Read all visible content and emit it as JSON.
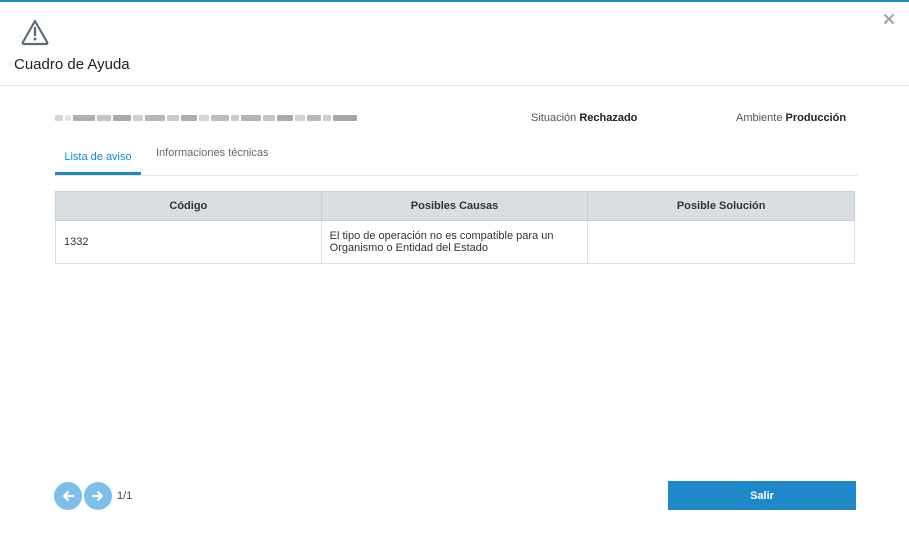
{
  "modal": {
    "title": "Cuadro de Ayuda",
    "warning_icon": "warning-triangle-icon",
    "close_icon": "close-icon"
  },
  "info": {
    "situacion_label": "Situación",
    "situacion_value": "Rechazado",
    "ambiente_label": "Ambiente",
    "ambiente_value": "Producción"
  },
  "tabs": [
    {
      "label": "Lista de aviso",
      "active": true
    },
    {
      "label": "Informaciones técnicas",
      "active": false
    }
  ],
  "table": {
    "headers": [
      "Código",
      "Posibles Causas",
      "Posible Solución"
    ],
    "rows": [
      {
        "codigo": "1332",
        "causa": "El tipo de operación no es compatible para un\nOrganismo o Entidad del Estado",
        "solucion": ""
      }
    ]
  },
  "pager": {
    "prev_icon": "arrow-left-icon",
    "next_icon": "arrow-right-icon",
    "count": "1/1"
  },
  "footer": {
    "salir_label": "Salir"
  },
  "colors": {
    "accent": "#1e88c9",
    "pager_button": "#7dbfe8",
    "table_header": "#d9dee3"
  }
}
